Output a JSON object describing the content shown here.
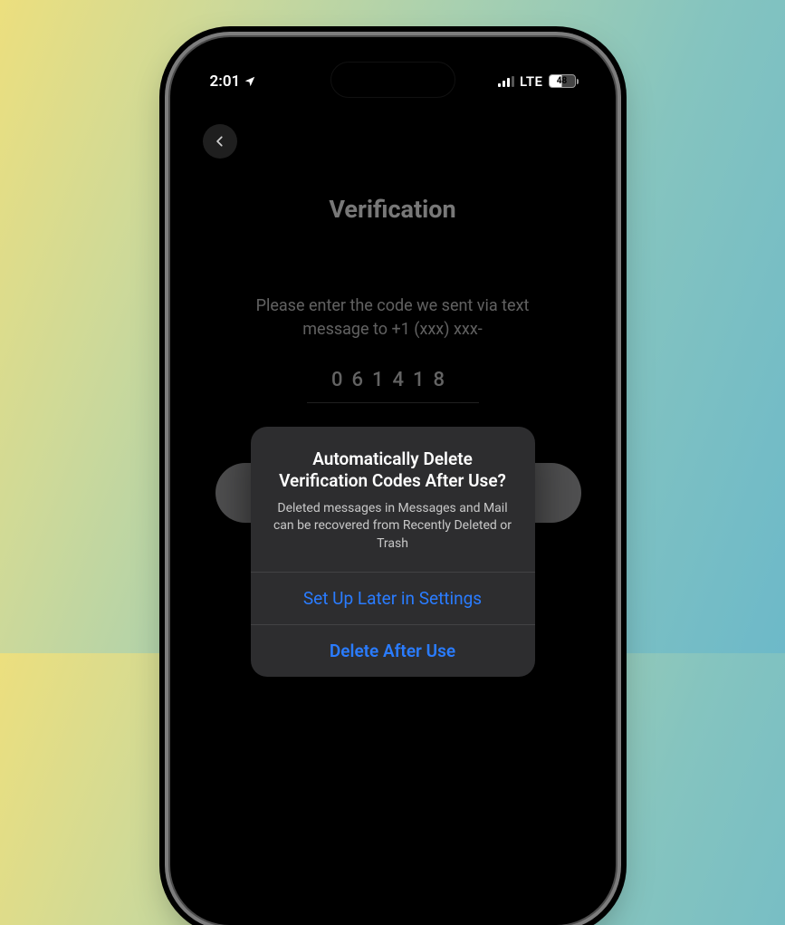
{
  "status": {
    "time": "2:01",
    "network": "LTE",
    "battery_pct": "48"
  },
  "page": {
    "title": "Verification",
    "lead_line1": "Please enter the code we sent via text",
    "lead_line2": "message to +1 (xxx) xxx-",
    "code_value": "061418"
  },
  "alert": {
    "title_line1": "Automatically Delete",
    "title_line2": "Verification Codes After Use?",
    "subtitle": "Deleted messages in Messages and Mail can be recovered from Recently Deleted or Trash",
    "later_label": "Set Up Later in Settings",
    "delete_label": "Delete After Use"
  }
}
